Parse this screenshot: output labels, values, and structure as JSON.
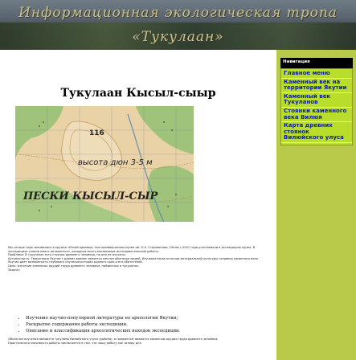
{
  "header": {
    "line1": "Информационная экологическая тропа",
    "line2": "«Тукулаан»"
  },
  "main": {
    "title": "Тукулаан Кысыл-сыыр",
    "map": {
      "label_height": "высота дюн 3-5 м",
      "label_name": "ПЕСКИ КЫСЫЛ-СЫР",
      "label_116": "116"
    },
    "intro_paragraphs": [
      "Мы четыре года занимались в кружке «Юный краевед» при краеведческом музее им. П.Х. Староватова. Летом с 2007 года участвовали в экспедициях музея. В экспедициях узнали много интересного, находили много материалов исследовательской работы.",
      "Проблема: В тукуланах есть стоянки древнего человека, но они не изучены.",
      "Актуальность: Территория Якутии с давних времен является местом обитания людей. Изучение мачи остатков материальной культуры человека каменного века Якутии дает возможность глубокого изучения истории родного края и его обитателей.",
      "Цель: изучение каменных орудий труда древнего человека, найденных в тукуланах.",
      "Задачи:"
    ],
    "tasks": [
      "Изучение научно-популярной литературы по археологии Якутии;",
      "Раскрытие содержания работы экспедиции.",
      "Описание и классификация археологических находок экспедиции."
    ],
    "outro_paragraphs": [
      "Объектом изучения являются тукуланы Вилюйского улуса (района), а предметом являются каменные орудия труда древнего человека.",
      "Практическая значимость работы заключается в том, что нашу работу как основу для"
    ]
  },
  "nav": {
    "heading": "Навигация",
    "items": [
      "Главное меню",
      "Каменный век на территории Якутии",
      "Каменный век Тукуланов",
      "Стоянки каменного века Вилюя",
      "Карта древних стоянок Вилюйского улуса"
    ]
  },
  "colors": {
    "page_background": "#b9c94a",
    "nav_background": "#b9dd2b",
    "nav_link": "#0a1f9a",
    "nav_heading_background": "#000000"
  }
}
